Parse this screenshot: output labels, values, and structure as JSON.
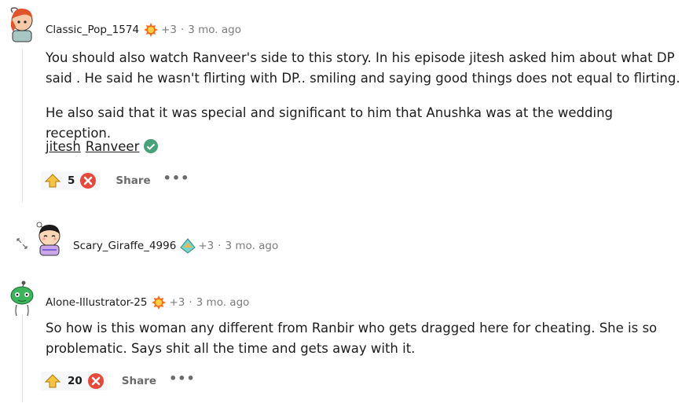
{
  "comments": [
    {
      "username": "Classic_Pop_1574",
      "bonus": "+3",
      "separator": "·",
      "time": "3 mo. ago",
      "paragraphs": [
        "You should also watch Ranveer's side to this story. In his episode jitesh asked him about what DP said . He said he wasn't flirting with DP.. smiling and saying good things does not equal to flirting.",
        "He also said that it was special and significant to him that Anushka was at the wedding reception."
      ],
      "mentions": [
        "jitesh",
        "Ranveer"
      ],
      "votes": "5",
      "share_label": "Share",
      "more_label": "•••"
    },
    {
      "username": "Scary_Giraffe_4996",
      "bonus": "+3",
      "separator": "·",
      "time": "3 mo. ago"
    },
    {
      "username": "Alone-Illustrator-25",
      "bonus": "+3",
      "separator": "·",
      "time": "3 mo. ago",
      "paragraphs": [
        "So how is this woman any different from Ranbir who gets dragged here for cheating. She is so problematic. Says shit all the time and gets away with it."
      ],
      "votes": "20",
      "share_label": "Share",
      "more_label": "•••"
    }
  ],
  "colors": {
    "upvote_fill": "#f5c542",
    "downvote_fill": "#e8473a",
    "verified": "#46a27a",
    "award": "#ff6b1a"
  },
  "icons": [
    "avatar",
    "award-icon",
    "upvote-icon",
    "downvote-icon",
    "verified-icon",
    "expand-icon"
  ]
}
